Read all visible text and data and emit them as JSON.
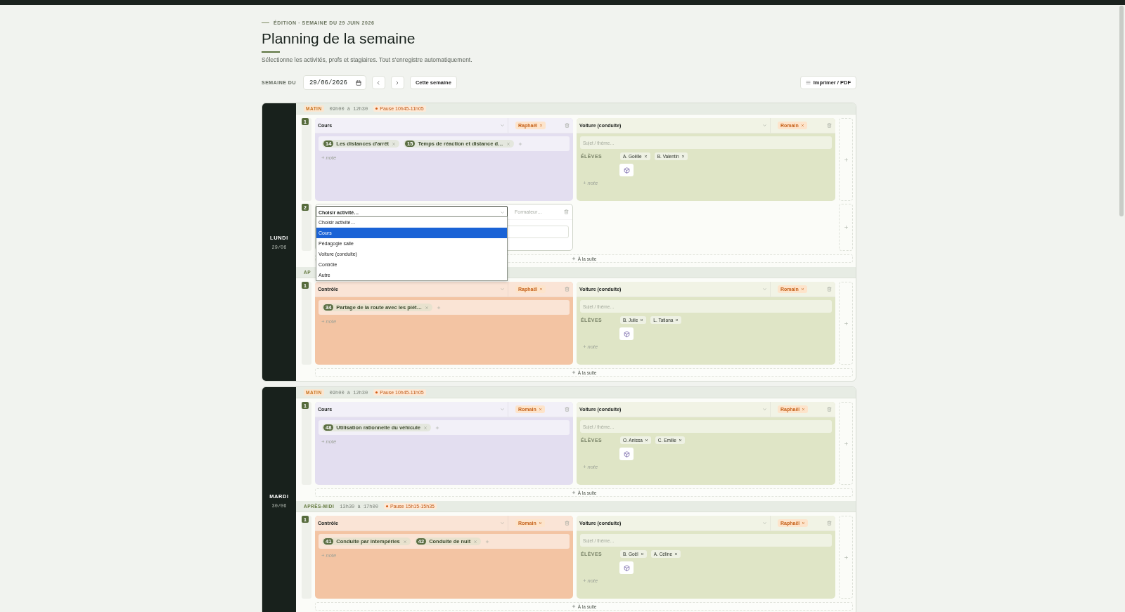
{
  "header": {
    "eyebrow": "ÉDITION · SEMAINE DU 29 JUIN 2026",
    "title": "Planning de la semaine",
    "subtitle": "Sélectionne les activités, profs et stagiaires. Tout s'enregistre automatiquement."
  },
  "toolbar": {
    "week_label": "SEMAINE DU",
    "date": "29/06/2026",
    "today_button": "Cette semaine",
    "print_button": "Imprimer / PDF"
  },
  "days": [
    {
      "name": "LUNDI",
      "date": "29/06",
      "sessions": [
        {
          "label": "MATIN",
          "kind": "morning",
          "hours": "09h00 à 12h30",
          "pause": "Pause 10h45-11h05",
          "add_after": "À la suite",
          "rows": [
            {
              "number": "1",
              "slots": [
                {
                  "kind": "course",
                  "color": "#e3def0",
                  "activity": "Cours",
                  "trainer": "Raphaël",
                  "topics": [
                    {
                      "number": "14",
                      "title": "Les distances d'arrêt"
                    },
                    {
                      "number": "15",
                      "title": "Temps de réaction et distance d…"
                    }
                  ],
                  "note": "+ note"
                },
                {
                  "kind": "driving",
                  "color": "#dfe5c6",
                  "activity": "Voiture (conduite)",
                  "trainer": "Romain",
                  "subject_placeholder": "Sujet / thème…",
                  "students_label": "ÉLÈVES",
                  "students": [
                    "A. Goëlle",
                    "B. Valentin"
                  ],
                  "note": "+ note"
                }
              ]
            },
            {
              "number": "2",
              "slots": [
                {
                  "kind": "empty",
                  "activity_placeholder": "Choisir activité…",
                  "trainer_placeholder": "Formateur…",
                  "open": true,
                  "options": [
                    {
                      "label": "Choisir activité…",
                      "selected": false
                    },
                    {
                      "label": "Cours",
                      "selected": true
                    },
                    {
                      "label": "Pédagogie salle",
                      "selected": false
                    },
                    {
                      "label": "Voiture (conduite)",
                      "selected": false
                    },
                    {
                      "label": "Contrôle",
                      "selected": false
                    },
                    {
                      "label": "Autre",
                      "selected": false
                    }
                  ]
                }
              ]
            }
          ]
        },
        {
          "label": "AP",
          "kind": "afternoon",
          "add_after": "À la suite",
          "rows": [
            {
              "number": "1",
              "slots": [
                {
                  "kind": "course",
                  "color": "#f3c4a3",
                  "activity": "Contrôle",
                  "trainer": "Raphaël",
                  "topics": [
                    {
                      "number": "34",
                      "title": "Partage de la route avec les piét…"
                    }
                  ],
                  "note": "+ note"
                },
                {
                  "kind": "driving",
                  "color": "#dfe5c6",
                  "activity": "Voiture (conduite)",
                  "trainer": "Romain",
                  "subject_placeholder": "Sujet / thème…",
                  "students_label": "ÉLÈVES",
                  "students": [
                    "B. Julie",
                    "L. Tatiana"
                  ],
                  "note": "+ note"
                }
              ]
            }
          ]
        }
      ]
    },
    {
      "name": "MARDI",
      "date": "30/06",
      "sessions": [
        {
          "label": "MATIN",
          "kind": "morning",
          "hours": "09h00 à 12h30",
          "pause": "Pause 10h45-11h05",
          "add_after": "À la suite",
          "rows": [
            {
              "number": "1",
              "slots": [
                {
                  "kind": "course",
                  "color": "#e3def0",
                  "activity": "Cours",
                  "trainer": "Romain",
                  "topics": [
                    {
                      "number": "48",
                      "title": "Utilisation rationnelle du véhicule"
                    }
                  ],
                  "note": "+ note"
                },
                {
                  "kind": "driving",
                  "color": "#dfe5c6",
                  "activity": "Voiture (conduite)",
                  "trainer": "Raphaël",
                  "subject_placeholder": "Sujet / thème…",
                  "students_label": "ÉLÈVES",
                  "students": [
                    "O. Anissa",
                    "C. Emilie"
                  ],
                  "note": "+ note"
                }
              ]
            }
          ]
        },
        {
          "label": "APRÈS-MIDI",
          "kind": "afternoon",
          "hours": "13h30 à 17h00",
          "pause": "Pause 15h15-15h35",
          "add_after": "À la suite",
          "rows": [
            {
              "number": "1",
              "slots": [
                {
                  "kind": "course",
                  "color": "#f3c4a3",
                  "activity": "Contrôle",
                  "trainer": "Romain",
                  "topics": [
                    {
                      "number": "41",
                      "title": "Conduite par intempéries"
                    },
                    {
                      "number": "42",
                      "title": "Conduite de nuit"
                    }
                  ],
                  "note": "+ note"
                },
                {
                  "kind": "driving",
                  "color": "#dfe5c6",
                  "activity": "Voiture (conduite)",
                  "trainer": "Raphaël",
                  "subject_placeholder": "Sujet / thème…",
                  "students_label": "ÉLÈVES",
                  "students": [
                    "B. Goël",
                    "A. Céline"
                  ],
                  "note": "+ note"
                }
              ]
            }
          ]
        }
      ]
    }
  ]
}
